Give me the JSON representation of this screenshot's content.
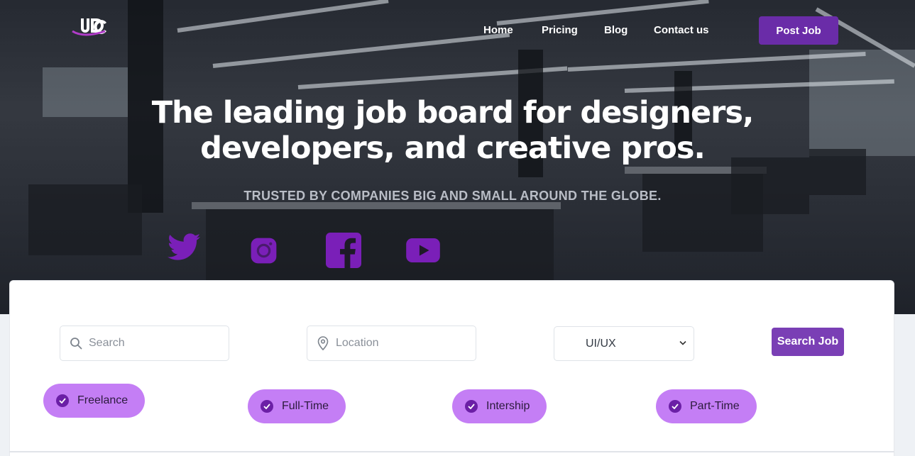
{
  "brand": {
    "logo_text": "JDC",
    "accent": "#6a2ca8",
    "chip_color": "#c47ef5",
    "icon_color": "#7a1fb8"
  },
  "nav": {
    "items": [
      {
        "label": "Home"
      },
      {
        "label": "Pricing"
      },
      {
        "label": "Blog"
      },
      {
        "label": "Contact us"
      }
    ],
    "cta": "Post Job"
  },
  "hero": {
    "headline_line1": "The leading job board for designers,",
    "headline_line2": "developers, and creative pros.",
    "tagline": "TRUSTED BY COMPANIES BIG AND SMALL AROUND THE GLOBE.",
    "social": [
      "twitter-icon",
      "instagram-icon",
      "facebook-icon",
      "youtube-icon"
    ]
  },
  "search": {
    "keyword_placeholder": "Search",
    "location_placeholder": "Location",
    "category_selected": "UI/UX",
    "button_label": "Search Job"
  },
  "job_types": [
    {
      "label": "Freelance"
    },
    {
      "label": "Full-Time"
    },
    {
      "label": "Intership"
    },
    {
      "label": "Part-Time"
    }
  ]
}
